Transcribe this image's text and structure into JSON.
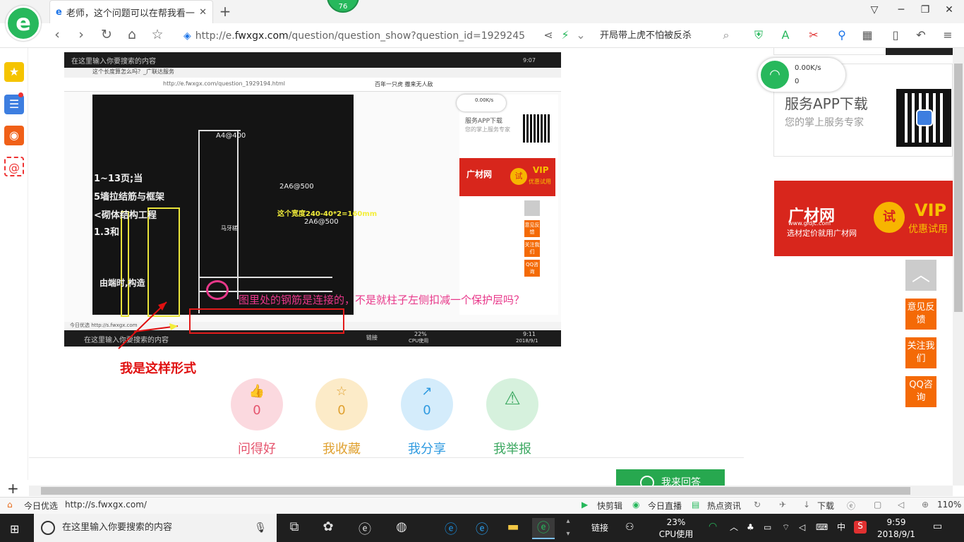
{
  "browser": {
    "tab_title": "老师，这个问题可以在帮我看一下",
    "tab_icon": "e",
    "badge": "76",
    "url": "http://e.fwxgx.com/question/question_show?question_id=1929245",
    "url_prefix": "http://e.",
    "url_domain": "fwxgx.com",
    "url_path": "/question/question_show?question_id=1929245",
    "search_text": "开局带上虎不怕被反杀",
    "logo_letter": "e"
  },
  "content": {
    "embedded": {
      "top_search": "在这里输入你要搜索的内容",
      "clock_time": "9:07",
      "clock_date": "2018/9/1",
      "inner_tab": "这个长度算怎么吗？_广联达服务",
      "inner_url": "http://e.fwxgx.com/question_1929194.html",
      "inner_search": "百年一只虎  撒来无人敌",
      "cad_label_1": "A4@400",
      "cad_label_2": "2A6@500",
      "cad_label_3": "2A6@500",
      "cad_width_note": "这个宽度240-40*2=160mm",
      "cad_text_1": "1~13页;当",
      "cad_text_2": "5墙拉结筋与框架",
      "cad_text_3": "<砌体结构工程",
      "cad_text_4": "1.3和",
      "cad_text_5": "由端时,构造",
      "cad_text_6": "马牙槎",
      "inner_status": "今日优选  http://s.fwxgx.com",
      "inner_app": "服务APP下载",
      "inner_app_sub": "您的掌上服务专家",
      "inner_brand": "广材网",
      "inner_vip": "VIP",
      "inner_vip_sub": "优惠试用",
      "inner_try": "试",
      "inner_btn_1": "意见反馈",
      "inner_btn_2": "关注我们",
      "inner_btn_3": "QQ咨询",
      "inner_speed": "0.00K/s",
      "bottom_search": "在这里输入你要搜索的内容",
      "bottom_cpu": "22%",
      "bottom_cpu_label": "CPU使用",
      "bottom_time": "9:11",
      "bottom_date": "2018/9/1",
      "bottom_link": "链接"
    },
    "annotation_pink": "图里处的钢筋是连接的，不是就柱子左侧扣减一个保护层吗？",
    "annotation_red": "我是这样形式",
    "votes": [
      {
        "label": "问得好",
        "count": "0",
        "color": "#e5546d",
        "bg": "#fbd9df",
        "icon": "thumbs-up-icon",
        "glyph": "👍"
      },
      {
        "label": "我收藏",
        "count": "0",
        "color": "#e0a130",
        "bg": "#fcebc8",
        "icon": "star-icon",
        "glyph": "☆"
      },
      {
        "label": "我分享",
        "count": "0",
        "color": "#2e9ae0",
        "bg": "#d4ecfb",
        "icon": "share-icon",
        "glyph": "↗"
      },
      {
        "label": "我举报",
        "count": "",
        "color": "#3ca861",
        "bg": "#d6f1dd",
        "icon": "warning-icon",
        "glyph": "⚠"
      }
    ],
    "answer_button": "我来回答"
  },
  "right_panel": {
    "speed": "0.00K/s",
    "count": "0",
    "app_title": "服务APP下载",
    "app_sub": "您的掌上服务专家",
    "brand": "广材网",
    "brand_sub": "选材定价就用广材网",
    "brand_domain": "www.gldjc.com",
    "try": "试",
    "vip": "VIP",
    "vip_sub": "优惠试用",
    "buttons": [
      "意见反馈",
      "关注我们",
      "QQ咨询"
    ]
  },
  "statusbar": {
    "left_label": "今日优选",
    "left_url": "http://s.fwxgx.com/",
    "items": [
      "快剪辑",
      "今日直播",
      "热点资讯",
      "下载"
    ],
    "zoom": "110%"
  },
  "taskbar": {
    "search_placeholder": "在这里输入你要搜索的内容",
    "link": "链接",
    "cpu_percent": "23%",
    "cpu_label": "CPU使用",
    "ime": "中",
    "time": "9:59",
    "date": "2018/9/1"
  },
  "colors": {
    "brand_green": "#27b85c",
    "accent_orange": "#f46a06",
    "banner_red": "#d8261c"
  }
}
